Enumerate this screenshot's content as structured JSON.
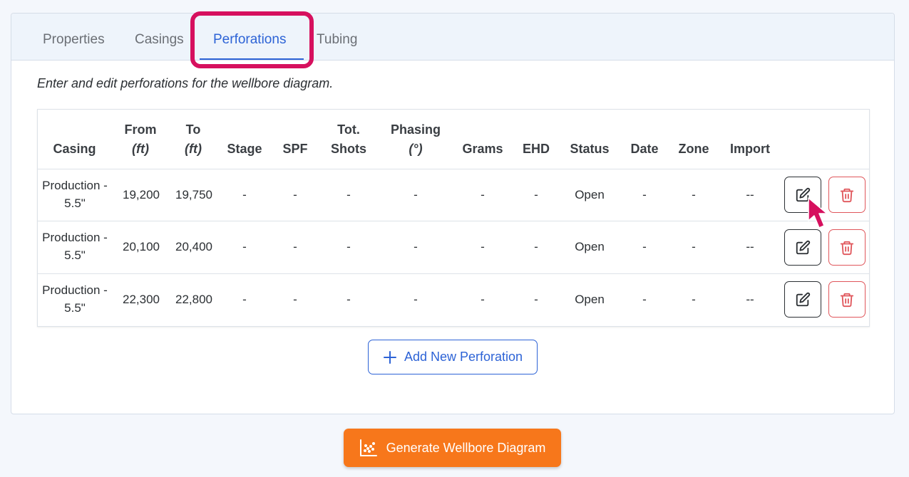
{
  "tabs": [
    {
      "label": "Properties",
      "active": false
    },
    {
      "label": "Casings",
      "active": false
    },
    {
      "label": "Perforations",
      "active": true
    },
    {
      "label": "Tubing",
      "active": false
    }
  ],
  "description": "Enter and edit perforations for the wellbore diagram.",
  "table": {
    "headers": {
      "casing": "Casing",
      "from": "From",
      "from_unit": "(ft)",
      "to": "To",
      "to_unit": "(ft)",
      "stage": "Stage",
      "spf": "SPF",
      "tot": "Tot.",
      "shots": "Shots",
      "phasing": "Phasing",
      "phasing_unit": "(°)",
      "grams": "Grams",
      "ehd": "EHD",
      "status": "Status",
      "date": "Date",
      "zone": "Zone",
      "import": "Import"
    },
    "rows": [
      {
        "casing_1": "Production -",
        "casing_2": "5.5\"",
        "from": "19,200",
        "to": "19,750",
        "stage": "-",
        "spf": "-",
        "shots": "-",
        "phasing": "-",
        "grams": "-",
        "ehd": "-",
        "status": "Open",
        "date": "-",
        "zone": "-",
        "import": "--"
      },
      {
        "casing_1": "Production -",
        "casing_2": "5.5\"",
        "from": "20,100",
        "to": "20,400",
        "stage": "-",
        "spf": "-",
        "shots": "-",
        "phasing": "-",
        "grams": "-",
        "ehd": "-",
        "status": "Open",
        "date": "-",
        "zone": "-",
        "import": "--"
      },
      {
        "casing_1": "Production -",
        "casing_2": "5.5\"",
        "from": "22,300",
        "to": "22,800",
        "stage": "-",
        "spf": "-",
        "shots": "-",
        "phasing": "-",
        "grams": "-",
        "ehd": "-",
        "status": "Open",
        "date": "-",
        "zone": "-",
        "import": "--"
      }
    ]
  },
  "add_button_label": "Add New Perforation",
  "generate_button_label": "Generate Wellbore Diagram",
  "colors": {
    "accent": "#2d63d6",
    "highlight": "#d6105e",
    "delete": "#e0565b",
    "generate": "#f7771b"
  }
}
